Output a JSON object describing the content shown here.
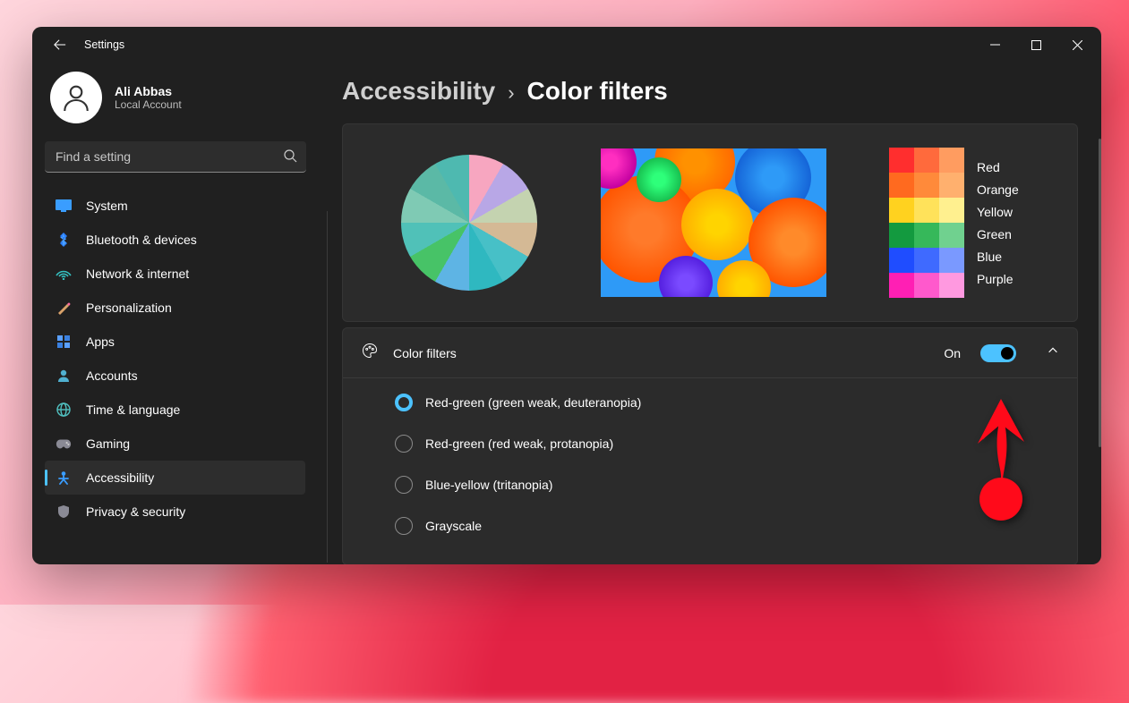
{
  "titlebar": {
    "title": "Settings"
  },
  "profile": {
    "name": "Ali Abbas",
    "account_type": "Local Account"
  },
  "search": {
    "placeholder": "Find a setting"
  },
  "nav": {
    "items": [
      {
        "label": "System"
      },
      {
        "label": "Bluetooth & devices"
      },
      {
        "label": "Network & internet"
      },
      {
        "label": "Personalization"
      },
      {
        "label": "Apps"
      },
      {
        "label": "Accounts"
      },
      {
        "label": "Time & language"
      },
      {
        "label": "Gaming"
      },
      {
        "label": "Accessibility"
      },
      {
        "label": "Privacy & security"
      }
    ],
    "active_index": 8
  },
  "breadcrumb": {
    "parent": "Accessibility",
    "child": "Color filters"
  },
  "swatches": {
    "labels": [
      "Red",
      "Orange",
      "Yellow",
      "Green",
      "Blue",
      "Purple"
    ],
    "colors": [
      [
        "#ff2e2e",
        "#ff6a3c",
        "#ff9c60"
      ],
      [
        "#ff6a1f",
        "#ff8a3a",
        "#ffb06e"
      ],
      [
        "#ffd21f",
        "#ffe25a",
        "#fff08f"
      ],
      [
        "#139a3f",
        "#36b85a",
        "#70d18f"
      ],
      [
        "#1f4dff",
        "#3f6aff",
        "#7a99ff"
      ],
      [
        "#ff1fb4",
        "#ff59cc",
        "#ff99e0"
      ]
    ]
  },
  "setting": {
    "label": "Color filters",
    "state": "On",
    "options": [
      "Red-green (green weak, deuteranopia)",
      "Red-green (red weak, protanopia)",
      "Blue-yellow (tritanopia)",
      "Grayscale"
    ],
    "selected_index": 0
  }
}
